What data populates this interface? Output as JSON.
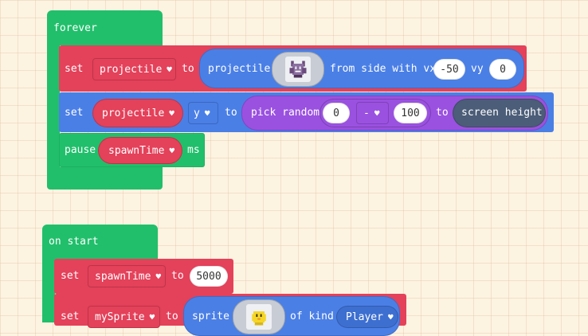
{
  "forever_block": {
    "label": "forever",
    "set1": {
      "set_label": "set",
      "variable": "projectile",
      "to_label": "to",
      "fn_label": "projectile",
      "from_label": "from side with vx",
      "vx": "-50",
      "vy_label": "vy",
      "vy": "0",
      "image_icon": "bat-sprite-icon"
    },
    "set2": {
      "set_label": "set",
      "variable": "projectile",
      "property": "y",
      "to_label": "to",
      "pick_label": "pick random",
      "min": "0",
      "op": "-",
      "max": "100",
      "to2_label": "to",
      "height_label": "screen height"
    },
    "pause": {
      "label": "pause",
      "variable": "spawnTime",
      "unit": "ms"
    }
  },
  "start_block": {
    "label": "on start",
    "set1": {
      "set_label": "set",
      "variable": "spawnTime",
      "to_label": "to",
      "value": "5000"
    },
    "set2": {
      "set_label": "set",
      "variable": "mySprite",
      "to_label": "to",
      "fn_label": "sprite",
      "kind_label": "of kind",
      "kind": "Player",
      "image_icon": "duck-sprite-icon"
    }
  },
  "colors": {
    "loops": "#21bf6b",
    "variables": "#e4415a",
    "sprites": "#4a7fe6",
    "math": "#9a51e0",
    "scene": "#4b5d78"
  }
}
